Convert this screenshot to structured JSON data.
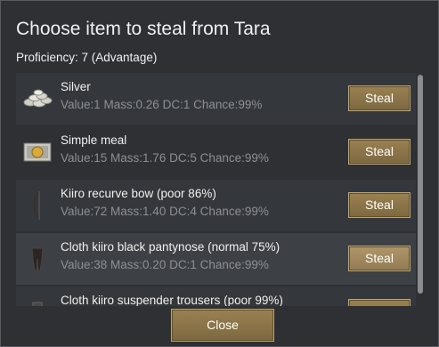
{
  "dialog": {
    "title": "Choose item to steal from Tara",
    "proficiency": "Proficiency: 7 (Advantage)",
    "close_label": "Close"
  },
  "items": [
    {
      "name": "Silver",
      "stats": "Value:1 Mass:0.26 DC:1 Chance:99%",
      "icon": "silver-coins-icon",
      "button": "Steal"
    },
    {
      "name": "Simple meal",
      "stats": "Value:15 Mass:1.76 DC:5 Chance:99%",
      "icon": "simple-meal-icon",
      "button": "Steal"
    },
    {
      "name": "Kiiro recurve bow (poor 86%)",
      "stats": "Value:72 Mass:1.40 DC:4 Chance:99%",
      "icon": "recurve-bow-icon",
      "button": "Steal"
    },
    {
      "name": "Cloth kiiro black pantynose (normal 75%)",
      "stats": "Value:38 Mass:0.20 DC:1 Chance:99%",
      "icon": "pantyhose-icon",
      "button": "Steal"
    },
    {
      "name": "Cloth kiiro suspender trousers (poor 99%)",
      "stats": "",
      "icon": "trousers-icon",
      "button": "Steal"
    }
  ]
}
